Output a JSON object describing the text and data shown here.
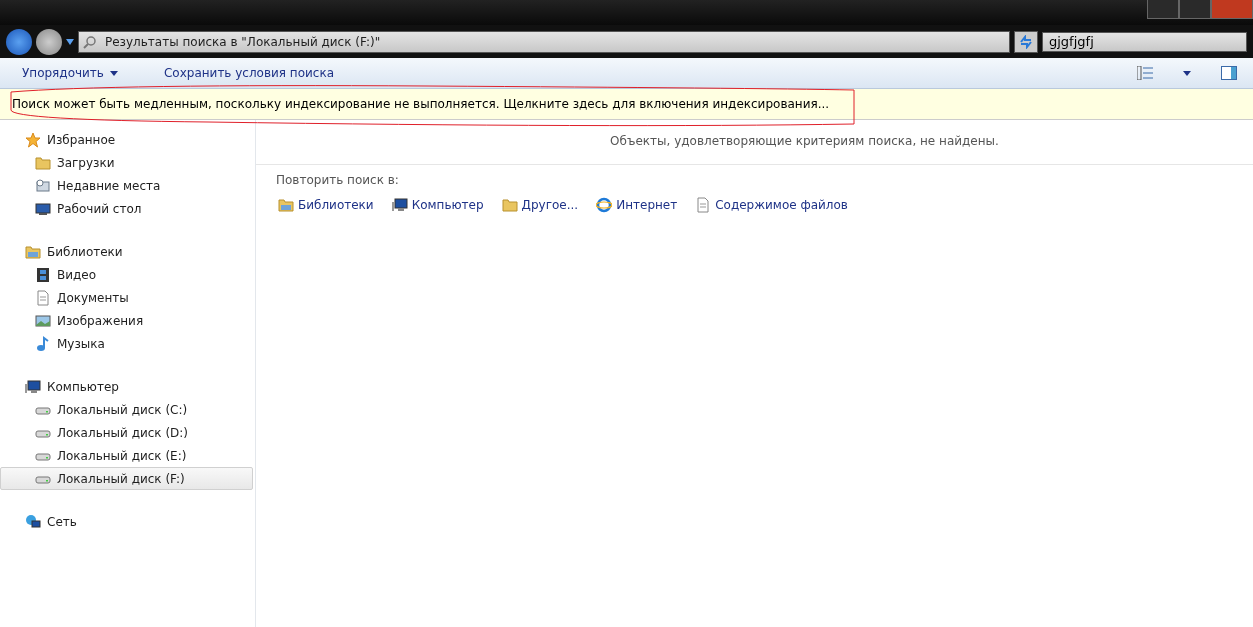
{
  "address_bar": {
    "path": "Результаты поиска в \"Локальный диск (F:)\""
  },
  "search": {
    "value": "gjgfjgfj"
  },
  "toolbar": {
    "items": [
      {
        "label": "Упорядочить",
        "kind": "menu"
      },
      {
        "label": "Сохранить условия поиска",
        "kind": "button"
      }
    ]
  },
  "info_bar": {
    "text": "Поиск может быть медленным, поскольку индексирование не выполняется.  Щелкните здесь для включения индексирования..."
  },
  "sidebar": {
    "groups": [
      {
        "label": "Избранное",
        "kind": "star",
        "children": [
          {
            "label": "Загрузки",
            "kind": "folder",
            "selected": false
          },
          {
            "label": "Недавние места",
            "kind": "recent",
            "selected": false
          },
          {
            "label": "Рабочий стол",
            "kind": "desktop",
            "selected": false
          }
        ]
      },
      {
        "label": "Библиотеки",
        "kind": "library",
        "children": [
          {
            "label": "Видео",
            "kind": "film",
            "selected": false
          },
          {
            "label": "Документы",
            "kind": "document",
            "selected": false
          },
          {
            "label": "Изображения",
            "kind": "picture",
            "selected": false
          },
          {
            "label": "Музыка",
            "kind": "note",
            "selected": false
          }
        ]
      },
      {
        "label": "Компьютер",
        "kind": "computer",
        "children": [
          {
            "label": "Локальный диск (C:)",
            "kind": "drive",
            "selected": false
          },
          {
            "label": "Локальный диск (D:)",
            "kind": "drive",
            "selected": false
          },
          {
            "label": "Локальный диск (E:)",
            "kind": "drive",
            "selected": false
          },
          {
            "label": "Локальный диск (F:)",
            "kind": "drive",
            "selected": true
          }
        ]
      },
      {
        "label": "Сеть",
        "kind": "network"
      }
    ]
  },
  "content": {
    "message": "Объекты, удовлетворяющие критериям поиска, не найдены.",
    "repeat_label": "Повторить поиск в:",
    "locations": [
      {
        "label": "Библиотеки",
        "kind": "library"
      },
      {
        "label": "Компьютер",
        "kind": "computer"
      },
      {
        "label": "Другое...",
        "kind": "folder"
      },
      {
        "label": "Интернет",
        "kind": "globe"
      },
      {
        "label": "Содержимое файлов",
        "kind": "document"
      }
    ]
  }
}
